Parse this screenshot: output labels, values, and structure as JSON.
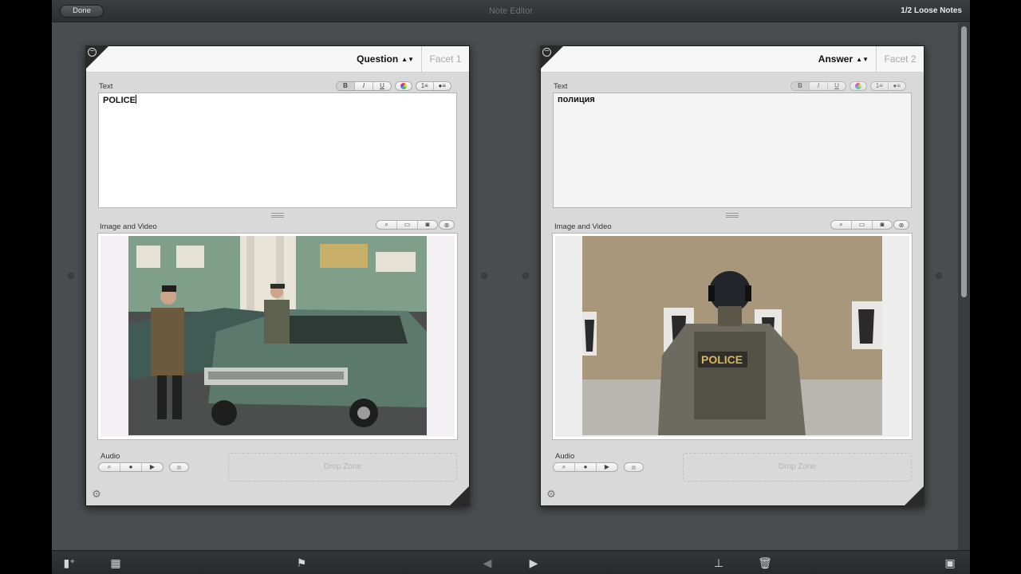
{
  "titlebar": {
    "done_label": "Done",
    "title": "Note Editor",
    "loose_notes": "1/2 Loose Notes"
  },
  "question_card": {
    "side_label": "Question",
    "facet_label": "Facet 1",
    "text_label": "Text",
    "text_value": "POLICE",
    "format_buttons": [
      "B",
      "I",
      "U"
    ],
    "list_buttons": [
      "1≡",
      "●≡"
    ],
    "media_label": "Image and Video",
    "audio_label": "Audio",
    "drop_zone": "Drop Zone"
  },
  "answer_card": {
    "side_label": "Answer",
    "facet_label": "Facet 2",
    "text_label": "Text",
    "text_value": "полиция",
    "format_buttons": [
      "B",
      "I",
      "U"
    ],
    "list_buttons": [
      "1≡",
      "●≡"
    ],
    "media_label": "Image and Video",
    "audio_label": "Audio",
    "drop_zone": "Drop Zone"
  },
  "icons": {
    "media_toolbar": [
      "search-icon",
      "window-icon",
      "camera-icon",
      "close-icon"
    ],
    "audio_controls": [
      "search-icon",
      "record-icon",
      "play-icon",
      "close-icon"
    ],
    "bottom_toolbar": [
      "add-note-icon",
      "add-multiple-icon",
      "flag-icon",
      "previous-icon",
      "next-icon",
      "stamp-icon",
      "trash-icon",
      "panel-icon"
    ]
  },
  "colors": {
    "window_bg": "#4a4c50",
    "card_bg": "#dcdcdc",
    "titlebar": "#2d2e31"
  }
}
